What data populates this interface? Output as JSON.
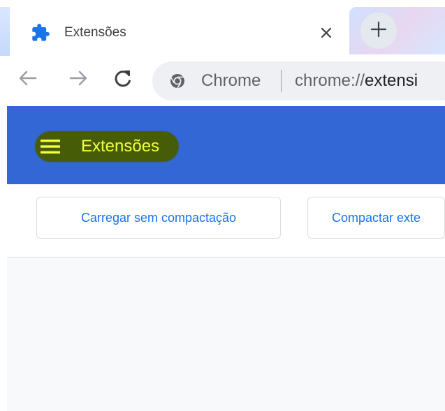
{
  "tab": {
    "title": "Extensões",
    "favicon": "puzzle-piece-icon",
    "close_icon": "close-icon"
  },
  "new_tab": {
    "icon": "plus-icon"
  },
  "toolbar": {
    "back_icon": "back-arrow-icon",
    "forward_icon": "forward-arrow-icon",
    "reload_icon": "reload-icon"
  },
  "omnibox": {
    "site_icon": "chrome-icon",
    "chip_label": "Chrome",
    "url_scheme": "chrome://",
    "url_host": "extensi"
  },
  "header": {
    "menu_icon": "hamburger-menu-icon",
    "title": "Extensões"
  },
  "actions": {
    "load_unpacked_label": "Carregar sem compactação",
    "pack_label": "Compactar exte"
  },
  "colors": {
    "header_blue": "#3367d6",
    "button_text_blue": "#1a73e8",
    "highlight_text": "#f4ff3b",
    "highlight_bg": "#475c06",
    "content_bg": "#f8f9fa"
  }
}
